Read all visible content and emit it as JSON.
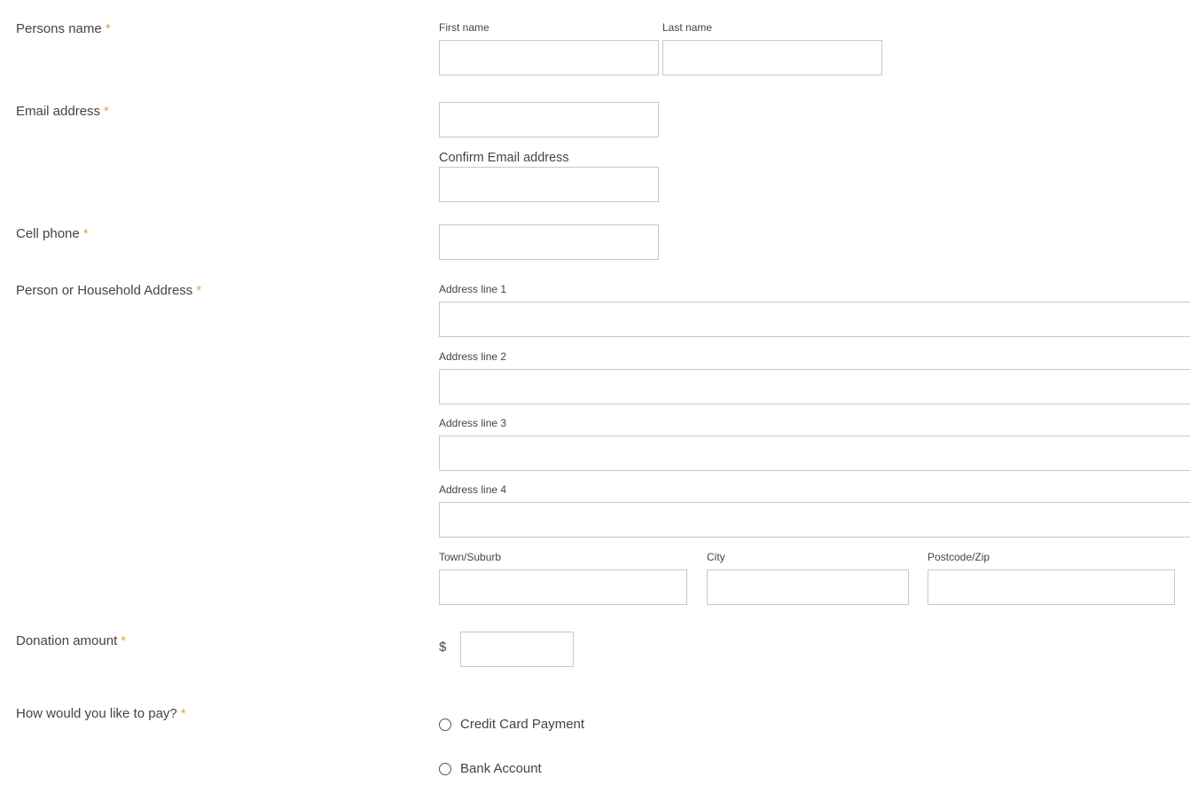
{
  "required_marker": "*",
  "colors": {
    "required_marker": "#e8a33c",
    "input_border": "#c8c8c8",
    "text": "#444444"
  },
  "name": {
    "label": "Persons name",
    "first_label": "First name",
    "last_label": "Last name",
    "first_value": "",
    "last_value": ""
  },
  "email": {
    "label": "Email address",
    "value": "",
    "confirm_label": "Confirm Email address",
    "confirm_value": ""
  },
  "phone": {
    "label": "Cell phone",
    "value": ""
  },
  "address": {
    "label": "Person or Household Address",
    "line1_label": "Address line 1",
    "line2_label": "Address line 2",
    "line3_label": "Address line 3",
    "line4_label": "Address line 4",
    "town_label": "Town/Suburb",
    "city_label": "City",
    "postcode_label": "Postcode/Zip",
    "line1_value": "",
    "line2_value": "",
    "line3_value": "",
    "line4_value": "",
    "town_value": "",
    "city_value": "",
    "postcode_value": ""
  },
  "donation": {
    "label": "Donation amount",
    "currency": "$",
    "value": ""
  },
  "payment": {
    "label": "How would you like to pay?",
    "options": [
      {
        "label": "Credit Card Payment",
        "selected": false
      },
      {
        "label": "Bank Account",
        "selected": false
      }
    ]
  }
}
